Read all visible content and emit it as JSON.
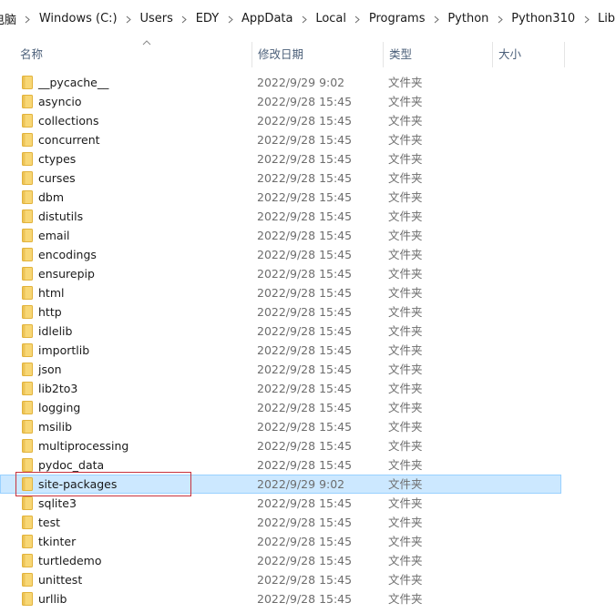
{
  "breadcrumb": {
    "items": [
      "电脑",
      "Windows (C:)",
      "Users",
      "EDY",
      "AppData",
      "Local",
      "Programs",
      "Python",
      "Python310",
      "Lib"
    ]
  },
  "columns": {
    "name": "名称",
    "date": "修改日期",
    "type": "类型",
    "size": "大小"
  },
  "files": [
    {
      "name": "__pycache__",
      "date": "2022/9/29 9:02",
      "type": "文件夹"
    },
    {
      "name": "asyncio",
      "date": "2022/9/28 15:45",
      "type": "文件夹"
    },
    {
      "name": "collections",
      "date": "2022/9/28 15:45",
      "type": "文件夹"
    },
    {
      "name": "concurrent",
      "date": "2022/9/28 15:45",
      "type": "文件夹"
    },
    {
      "name": "ctypes",
      "date": "2022/9/28 15:45",
      "type": "文件夹"
    },
    {
      "name": "curses",
      "date": "2022/9/28 15:45",
      "type": "文件夹"
    },
    {
      "name": "dbm",
      "date": "2022/9/28 15:45",
      "type": "文件夹"
    },
    {
      "name": "distutils",
      "date": "2022/9/28 15:45",
      "type": "文件夹"
    },
    {
      "name": "email",
      "date": "2022/9/28 15:45",
      "type": "文件夹"
    },
    {
      "name": "encodings",
      "date": "2022/9/28 15:45",
      "type": "文件夹"
    },
    {
      "name": "ensurepip",
      "date": "2022/9/28 15:45",
      "type": "文件夹"
    },
    {
      "name": "html",
      "date": "2022/9/28 15:45",
      "type": "文件夹"
    },
    {
      "name": "http",
      "date": "2022/9/28 15:45",
      "type": "文件夹"
    },
    {
      "name": "idlelib",
      "date": "2022/9/28 15:45",
      "type": "文件夹"
    },
    {
      "name": "importlib",
      "date": "2022/9/28 15:45",
      "type": "文件夹"
    },
    {
      "name": "json",
      "date": "2022/9/28 15:45",
      "type": "文件夹"
    },
    {
      "name": "lib2to3",
      "date": "2022/9/28 15:45",
      "type": "文件夹"
    },
    {
      "name": "logging",
      "date": "2022/9/28 15:45",
      "type": "文件夹"
    },
    {
      "name": "msilib",
      "date": "2022/9/28 15:45",
      "type": "文件夹"
    },
    {
      "name": "multiprocessing",
      "date": "2022/9/28 15:45",
      "type": "文件夹"
    },
    {
      "name": "pydoc_data",
      "date": "2022/9/28 15:45",
      "type": "文件夹"
    },
    {
      "name": "site-packages",
      "date": "2022/9/29 9:02",
      "type": "文件夹",
      "selected": true
    },
    {
      "name": "sqlite3",
      "date": "2022/9/28 15:45",
      "type": "文件夹"
    },
    {
      "name": "test",
      "date": "2022/9/28 15:45",
      "type": "文件夹"
    },
    {
      "name": "tkinter",
      "date": "2022/9/28 15:45",
      "type": "文件夹"
    },
    {
      "name": "turtledemo",
      "date": "2022/9/28 15:45",
      "type": "文件夹"
    },
    {
      "name": "unittest",
      "date": "2022/9/28 15:45",
      "type": "文件夹"
    },
    {
      "name": "urllib",
      "date": "2022/9/28 15:45",
      "type": "文件夹"
    }
  ],
  "colors": {
    "folder": "#f8d775",
    "folder_dark": "#e2b33c",
    "selection_bg": "#cce8ff",
    "selection_border": "#99d1ff",
    "highlight_box": "#c8323c",
    "header_text": "#4c607a"
  }
}
